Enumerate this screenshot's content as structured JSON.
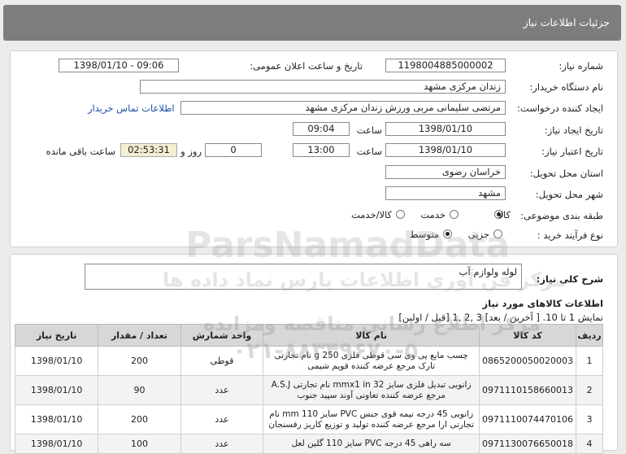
{
  "window": {
    "title": "جزئیات اطلاعات نیاز"
  },
  "form": {
    "need_number_label": "شماره نیاز:",
    "need_number": "1198004885000002",
    "announce_label": "تاریخ و ساعت اعلان عمومی:",
    "announce_value": "1398/01/10 - 09:06",
    "buyer_label": "نام دستگاه خریدار:",
    "buyer_value": "زندان مرکزی مشهد",
    "requester_label": "ایجاد کننده درخواست:",
    "requester_value": "مرتضی سلیمانی مربی ورزش زندان مرکزی مشهد",
    "contact_link": "اطلاعات تماس خریدار",
    "create_date_label": "تاریخ ایجاد نیاز:",
    "create_date": "1398/01/10",
    "time_label": "ساعت",
    "create_time": "09:04",
    "validity_label": "تاریخ اعتبار نیاز:",
    "validity_date": "1398/01/10",
    "validity_time": "13:00",
    "days_value": "0",
    "days_label": "روز و",
    "remaining_time": "02:53:31",
    "remaining_label": "ساعت باقی مانده",
    "province_label": "استان محل تحویل:",
    "province_value": "خراسان رضوی",
    "city_label": "شهر محل تحویل:",
    "city_value": "مشهد",
    "category_label": "طبقه بندی موضوعی:",
    "category_options": [
      "کالا",
      "خدمت",
      "کالا/خدمت"
    ],
    "category_selected": "کالا",
    "process_label": "نوع فرآیند خرید :",
    "process_options": [
      "جزیی",
      "متوسط"
    ],
    "process_selected": "متوسط"
  },
  "summary": {
    "label": "شرح کلی نیاز:",
    "value": "لوله ولوازم آب"
  },
  "items": {
    "heading": "اطلاعات کالاهای مورد نیاز",
    "pagination": "نمایش 1 تا 10. [ آخرین / بعد] 3 ,2 ,1 [قبل / اولین]",
    "columns": [
      "ردیف",
      "کد کالا",
      "نام کالا",
      "واحد شمارش",
      "تعداد / مقدار",
      "تاریخ نیاز"
    ],
    "rows": [
      {
        "row": "1",
        "code": "0865200050020003",
        "name": "چسب مایع پی وی سی قوطی فلزی 250 g نام تجارتی تارک مرجع عرضه کننده قویم شیمی",
        "unit": "قوطی",
        "qty": "200",
        "date": "1398/01/10"
      },
      {
        "row": "2",
        "code": "0971110158660013",
        "name": "زانویی تبدیل فلزی سایز mmx1 in 32 نام تجارتی A.S.J مرجع عرضه کننده تعاونی آوند سپید جنوب",
        "unit": "عدد",
        "qty": "90",
        "date": "1398/01/10"
      },
      {
        "row": "3",
        "code": "0971110074470106",
        "name": "زانویی 45 درجه نیمه قوی جنس PVC سایز mm 110 نام تجارتی ارا مرجع عرضه کننده تولید و توزیع کاریز رفسنجان",
        "unit": "عدد",
        "qty": "200",
        "date": "1398/01/10"
      },
      {
        "row": "4",
        "code": "0971130076650018",
        "name": "سه راهی 45 درجه PVC سایز 110 گلین لعل",
        "unit": "عدد",
        "qty": "100",
        "date": "1398/01/10"
      }
    ]
  },
  "watermark": {
    "brand": "ParsNamadData",
    "tagline": "مرکز فن آوری اطلاعات پارس نماد داده ها",
    "center": "مرکز اطلاع رسانی مناقصه ومزایده",
    "phone": "۰۲۱-۸۸۳۴۹۶۷۰-۵"
  }
}
